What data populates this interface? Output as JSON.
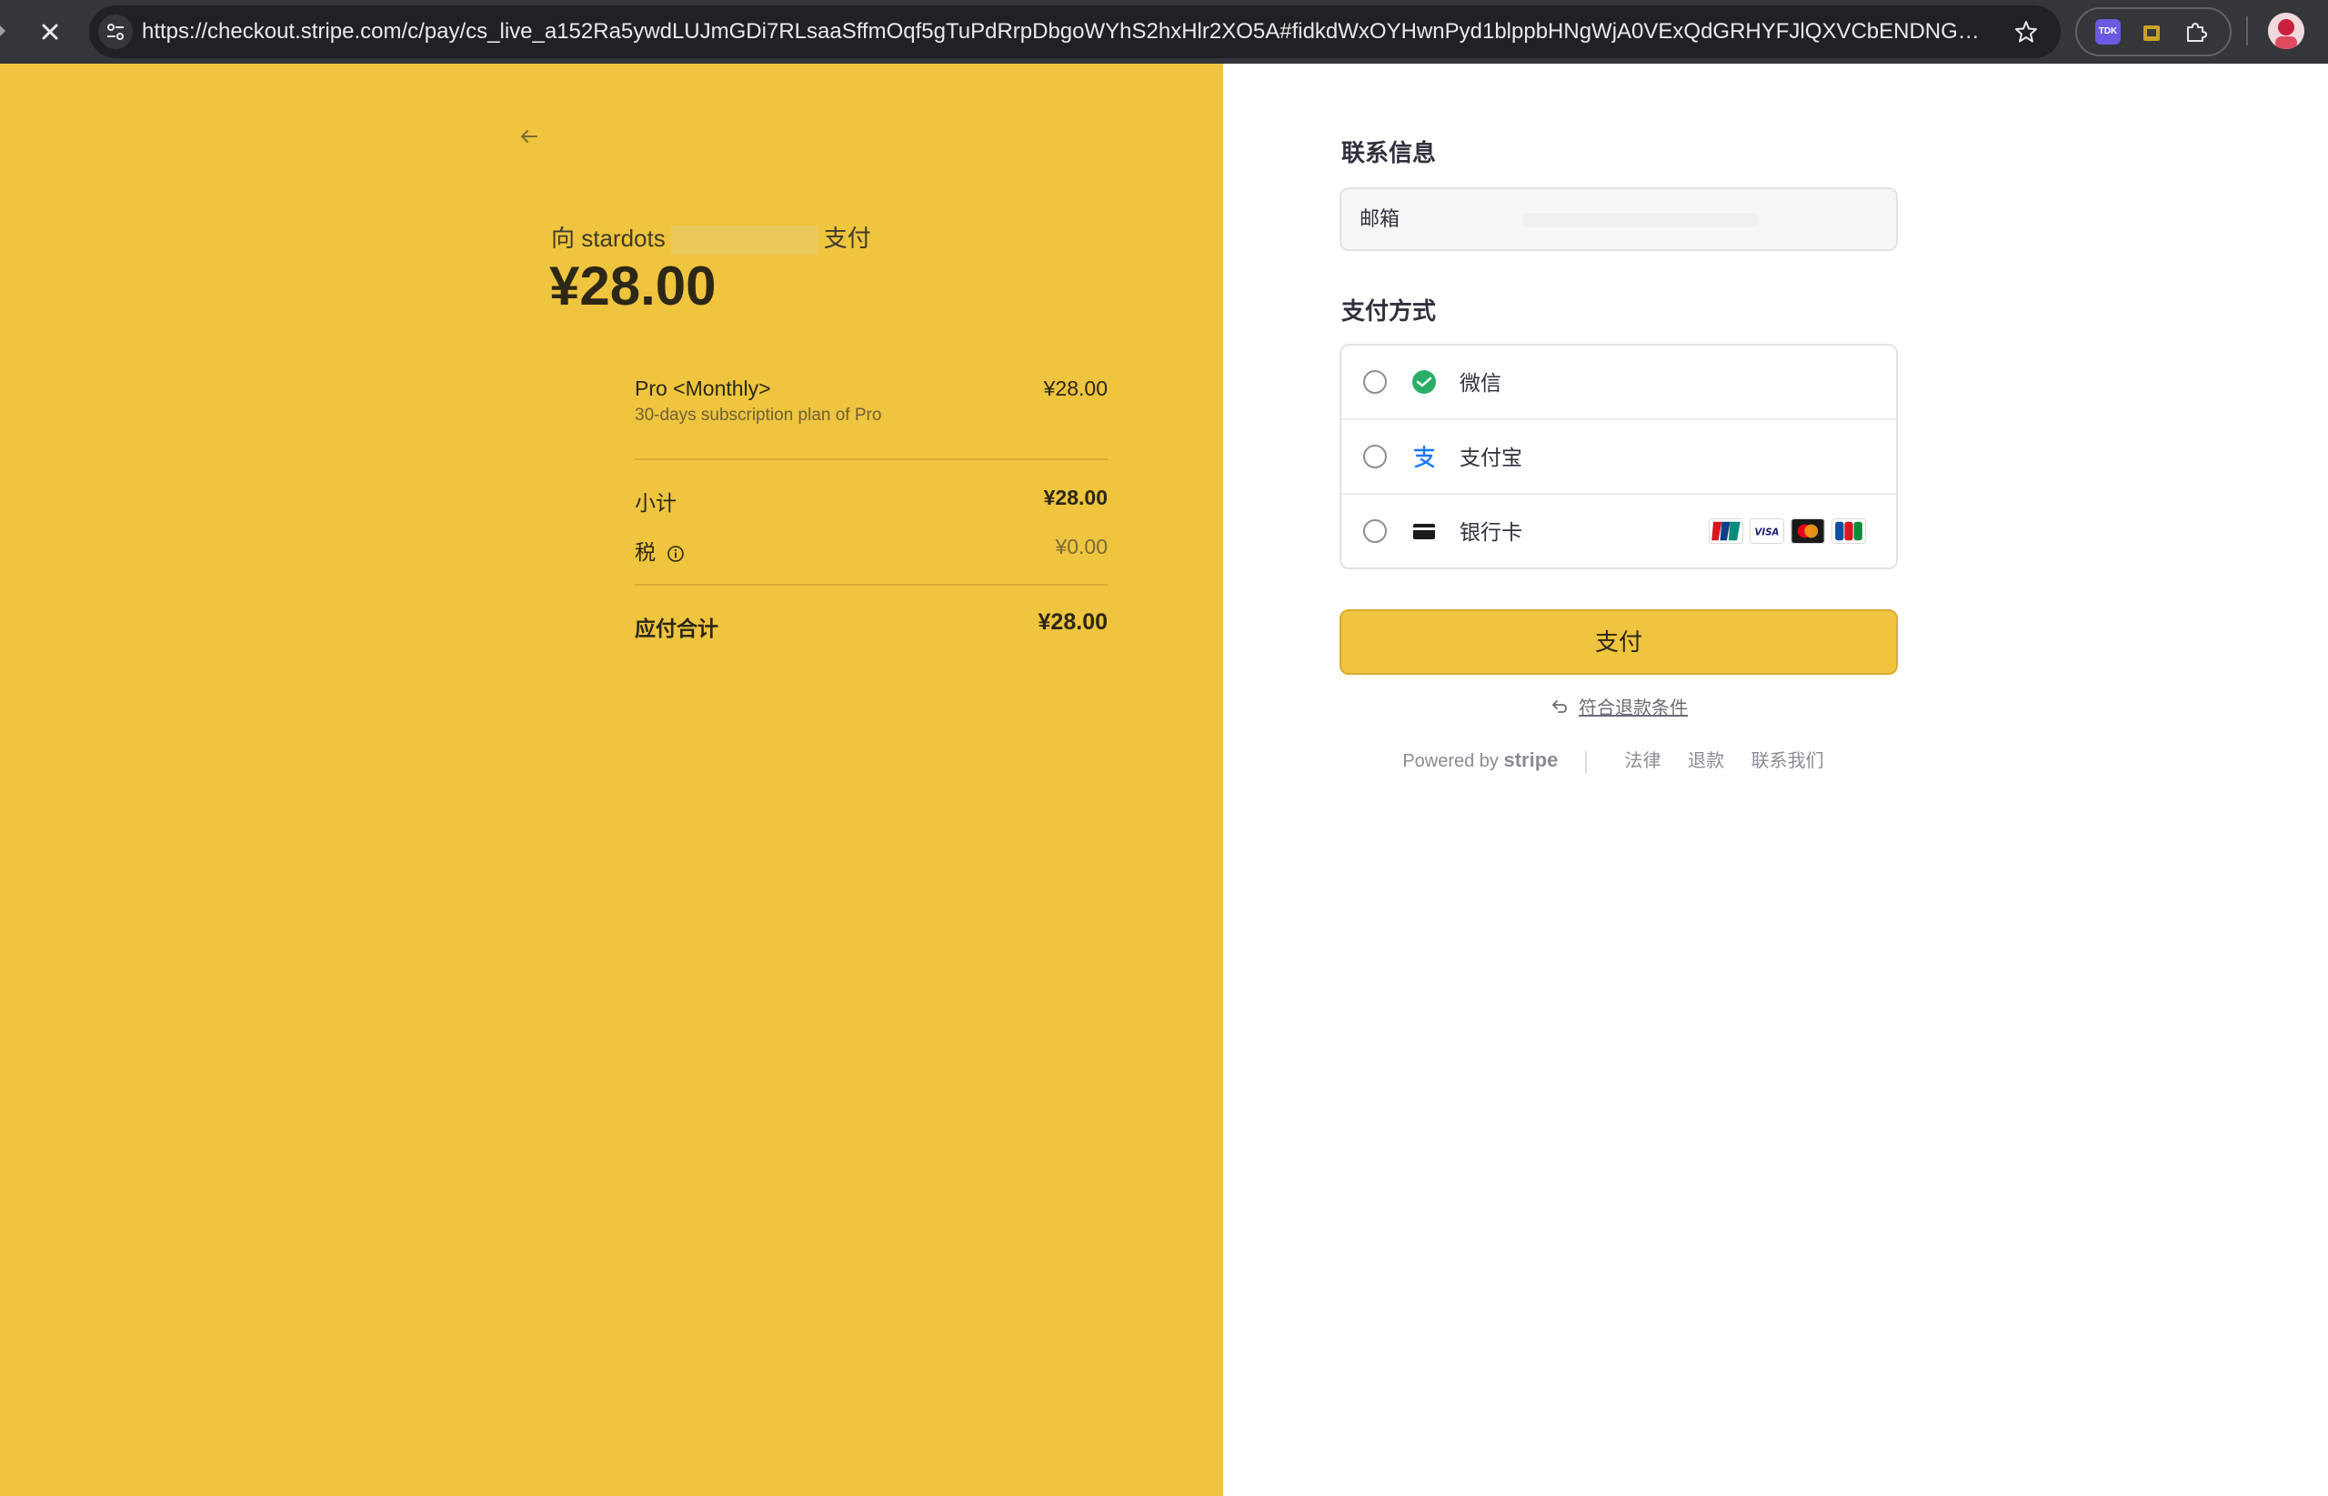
{
  "browser": {
    "url": "https://checkout.stripe.com/c/pay/cs_live_a152Ra5ywdLUJmGDi7RLsaaSffmOqf5gTuPdRrpDbgoWYhS2hxHlr2XO5A#fidkdWxOYHwnPyd1blppbHNgWjA0VExQdGRHYFJlQXVCbENDNGR8UU...",
    "extensions": [
      "TDK"
    ]
  },
  "summary": {
    "pay_to_prefix": "向 stardots",
    "pay_to_suffix": "支付",
    "amount": "¥28.00",
    "item": {
      "name": "Pro <Monthly>",
      "description": "30-days subscription plan of Pro",
      "price": "¥28.00"
    },
    "subtotal_label": "小计",
    "subtotal_value": "¥28.00",
    "tax_label": "税",
    "tax_value": "¥0.00",
    "total_label": "应付合计",
    "total_value": "¥28.00"
  },
  "checkout": {
    "contact_title": "联系信息",
    "email_label": "邮箱",
    "payment_title": "支付方式",
    "methods": [
      {
        "label": "微信",
        "icon": "wechat-icon",
        "selected": false
      },
      {
        "label": "支付宝",
        "icon": "alipay-icon",
        "selected": false
      },
      {
        "label": "银行卡",
        "icon": "card-icon",
        "selected": false
      }
    ],
    "card_brands": [
      "unionpay-icon",
      "visa-icon",
      "mastercard-icon",
      "jcb-icon"
    ],
    "visa_text": "VISA",
    "pay_button": "支付",
    "refund_link": "符合退款条件",
    "powered_by": "Powered by",
    "stripe_word": "stripe",
    "footer_links": [
      "法律",
      "退款",
      "联系我们"
    ]
  },
  "colors": {
    "brand_yellow": "#efc43f",
    "chrome_dark": "#35363a",
    "wechat_green": "#2aae67",
    "alipay_blue": "#1677ff"
  }
}
